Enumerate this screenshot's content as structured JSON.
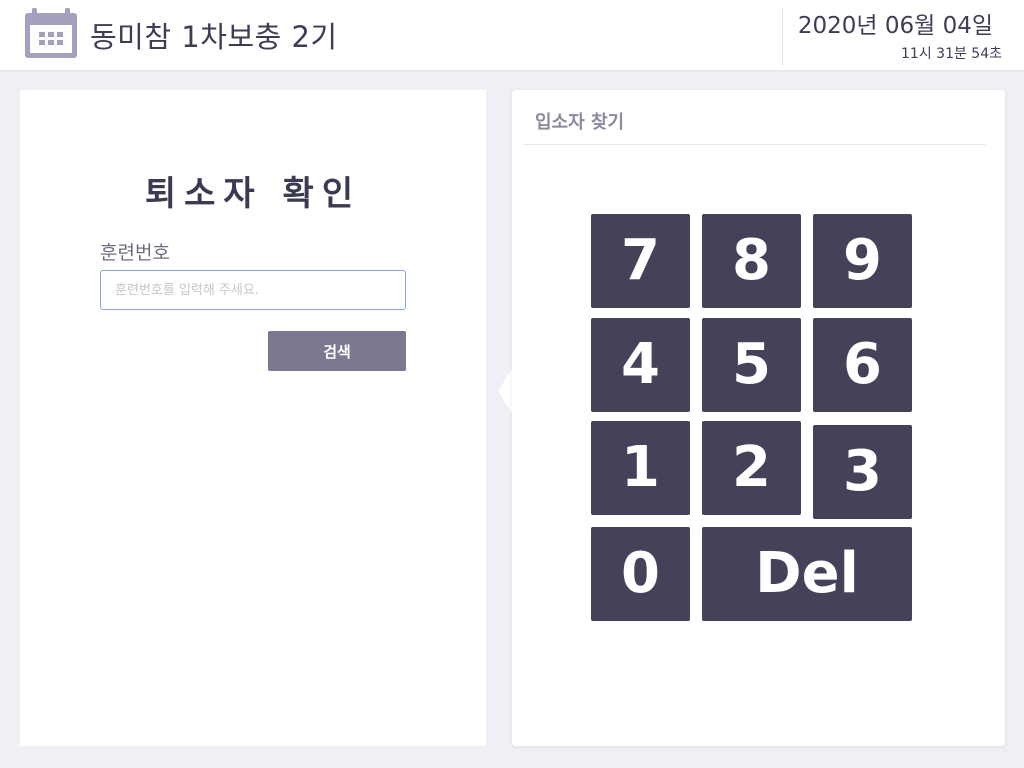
{
  "header": {
    "title": "동미참 1차보충 2기",
    "date": "2020년 06월 04일",
    "time": "11시 31분 54초",
    "icon": "calendar-icon",
    "icon_color": "#a3a1bd"
  },
  "checkout": {
    "title": "퇴소자 확인",
    "field_label": "훈련번호",
    "input_value": "",
    "input_placeholder": "훈련번호를 입력해 주세요.",
    "search_label": "검색"
  },
  "finder": {
    "title": "입소자 찾기",
    "keys": [
      "7",
      "8",
      "9",
      "4",
      "5",
      "6",
      "1",
      "2",
      "3",
      "0",
      "Del"
    ]
  },
  "colors": {
    "key_bg": "#434259",
    "search_bg": "#7b7890",
    "background": "#eef0f5",
    "input_border": "#8ca6dc"
  }
}
